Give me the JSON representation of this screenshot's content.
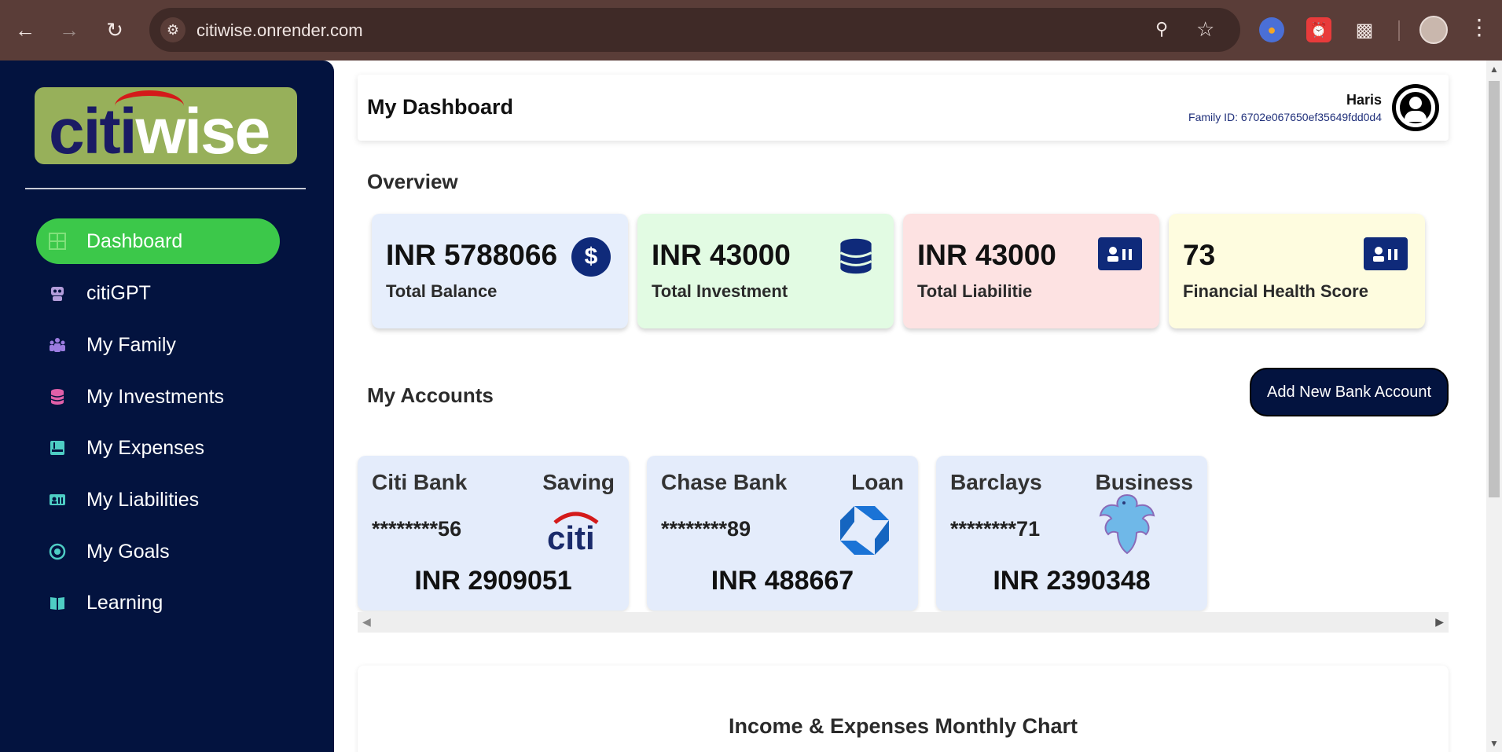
{
  "browser": {
    "url": "citiwise.onrender.com"
  },
  "sidebar": {
    "logo": {
      "citi": "citi",
      "wise": "wise"
    },
    "items": [
      {
        "label": "Dashboard",
        "icon": "grid-icon",
        "active": true
      },
      {
        "label": "citiGPT",
        "icon": "robot-icon"
      },
      {
        "label": "My Family",
        "icon": "family-icon"
      },
      {
        "label": "My Investments",
        "icon": "database-icon"
      },
      {
        "label": "My Expenses",
        "icon": "receipt-icon"
      },
      {
        "label": "My Liabilities",
        "icon": "id-card-icon"
      },
      {
        "label": "My Goals",
        "icon": "target-icon"
      },
      {
        "label": "Learning",
        "icon": "book-icon"
      }
    ]
  },
  "header": {
    "title": "My Dashboard",
    "user_name": "Haris",
    "family_id": "Family ID: 6702e067650ef35649fdd0d4"
  },
  "overview": {
    "title": "Overview",
    "cards": [
      {
        "value": "INR 5788066",
        "label": "Total Balance",
        "color": "#e6eefc",
        "icon": "dollar-icon"
      },
      {
        "value": "INR 43000",
        "label": "Total Investment",
        "color": "#e2fbe3",
        "icon": "database-icon"
      },
      {
        "value": "INR 43000",
        "label": "Total Liabilitie",
        "color": "#fde2e2",
        "icon": "id-card-icon"
      },
      {
        "value": "73",
        "label": "Financial Health Score",
        "color": "#fefcdf",
        "icon": "id-card-icon"
      }
    ]
  },
  "accounts": {
    "title": "My Accounts",
    "add_button": "Add New Bank Account",
    "items": [
      {
        "bank": "Citi Bank",
        "type": "Saving",
        "number": "********56",
        "balance": "INR 2909051",
        "logo": "citi-logo"
      },
      {
        "bank": "Chase Bank",
        "type": "Loan",
        "number": "********89",
        "balance": "INR 488667",
        "logo": "chase-logo"
      },
      {
        "bank": "Barclays",
        "type": "Business",
        "number": "********71",
        "balance": "INR 2390348",
        "logo": "barclays-eagle-logo"
      }
    ]
  },
  "chart": {
    "title": "Income & Expenses Monthly Chart"
  },
  "colors": {
    "sidebar_bg": "#03133f",
    "active_nav": "#3cc84a",
    "icon_blue": "#0f2a7a"
  }
}
